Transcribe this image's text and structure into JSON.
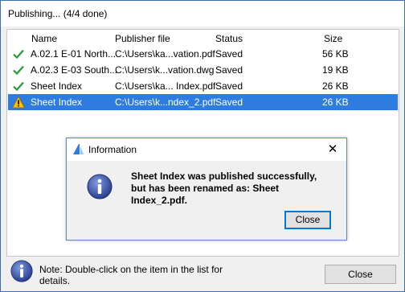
{
  "window": {
    "title": "Publishing... (4/4 done)"
  },
  "table": {
    "columns": [
      "Name",
      "Publisher file",
      "Status",
      "Size"
    ],
    "rows": [
      {
        "name": "A.02.1 E-01 North...",
        "file": "C:\\Users\\ka...vation.pdf",
        "status": "Saved",
        "size": "56 KB",
        "icon": "check-icon"
      },
      {
        "name": "A.02.3 E-03 South...",
        "file": "C:\\Users\\k...vation.dwg",
        "status": "Saved",
        "size": "19 KB",
        "icon": "check-icon"
      },
      {
        "name": "Sheet Index",
        "file": "C:\\Users\\ka... Index.pdf",
        "status": "Saved",
        "size": "26 KB",
        "icon": "check-icon"
      },
      {
        "name": "Sheet Index",
        "file": "C:\\Users\\k...ndex_2.pdf",
        "status": "Saved",
        "size": "26 KB",
        "icon": "warning-icon",
        "selected": true
      }
    ]
  },
  "dialog": {
    "title": "Information",
    "message": "Sheet Index was published successfully, but has been renamed as: Sheet Index_2.pdf.",
    "close_label": "Close",
    "close_x": "✕"
  },
  "footer": {
    "note": "Note: Double-click on the item in the list for details.",
    "close_label": "Close"
  },
  "colors": {
    "accent": "#2f7ce0",
    "check": "#1f9e3a",
    "warning": "#f2c014",
    "info_icon": "#3553a6"
  }
}
